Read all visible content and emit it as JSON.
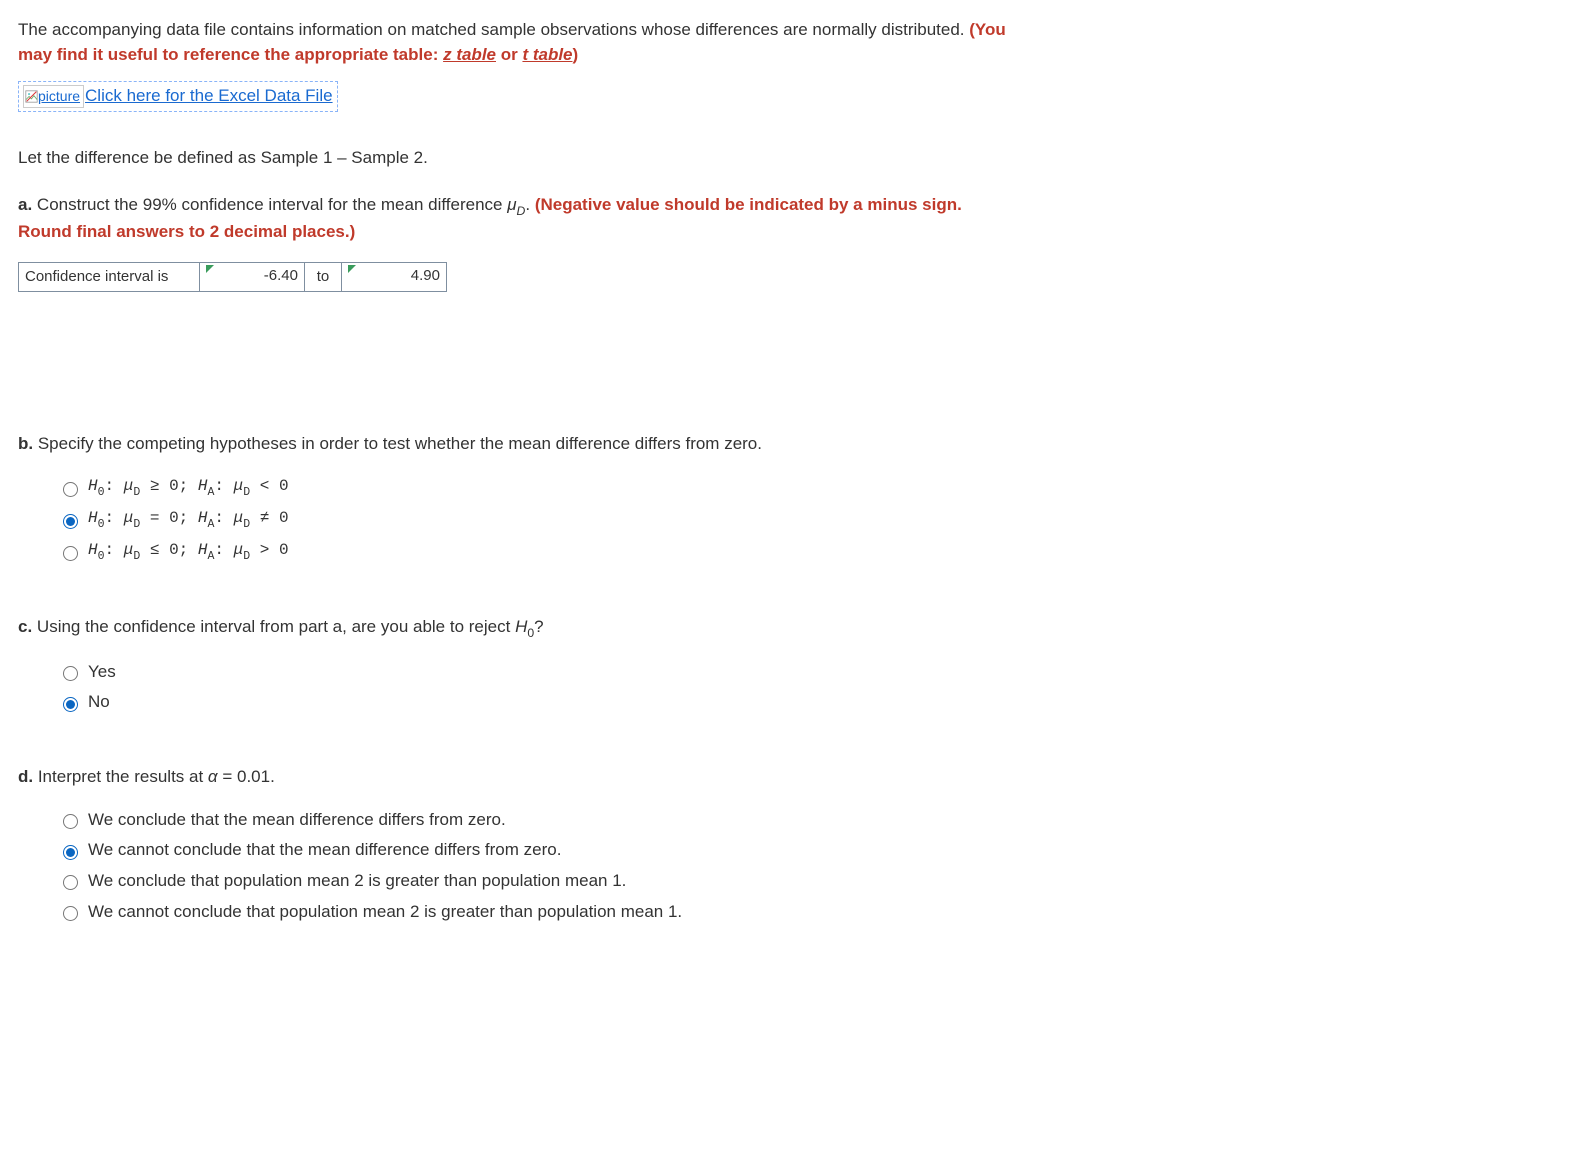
{
  "intro": {
    "text1": "The accompanying data file contains information on matched sample observations whose differences are normally distributed. ",
    "bold_open": "(You may find it useful to reference the appropriate table: ",
    "z_link": "z table",
    "or_text": " or ",
    "t_link": "t table",
    "bold_close": ")"
  },
  "excel": {
    "alt": "picture",
    "link_text": "Click here for the Excel Data File"
  },
  "diff_def": "Let the difference be defined as Sample 1 – Sample 2.",
  "a": {
    "label": "a.",
    "text": " Construct the 99% confidence interval for the mean difference ",
    "mu": "μ",
    "sub": "D",
    "after_mu": ". ",
    "bold": "(Negative value should be indicated by a minus sign. Round final answers to 2 decimal places.)",
    "ci_label": "Confidence interval is",
    "ci_low": "-6.40",
    "ci_to": "to",
    "ci_high": "4.90"
  },
  "b": {
    "label": "b.",
    "text": " Specify the competing hypotheses in order to test whether the mean difference differs from zero.",
    "options": [
      "H₀: μD ≥ 0; HA: μD < 0",
      "H₀: μD = 0; HA: μD ≠ 0",
      "H₀: μD ≤ 0; HA: μD > 0"
    ],
    "selected": 1
  },
  "c": {
    "label": "c.",
    "text_pre": " Using the confidence interval from part a, are you able to reject ",
    "h0": "H",
    "h0_sub": "0",
    "text_post": "?",
    "options": [
      "Yes",
      "No"
    ],
    "selected": 1
  },
  "d": {
    "label": "d.",
    "text_pre": " Interpret the results at ",
    "alpha": "α",
    "text_post": " = 0.01.",
    "options": [
      "We conclude that the mean difference differs from zero.",
      "We cannot conclude that the mean difference differs from zero.",
      "We conclude that population mean 2 is greater than population mean 1.",
      "We cannot conclude that population mean 2 is greater than population mean 1."
    ],
    "selected": 1
  }
}
